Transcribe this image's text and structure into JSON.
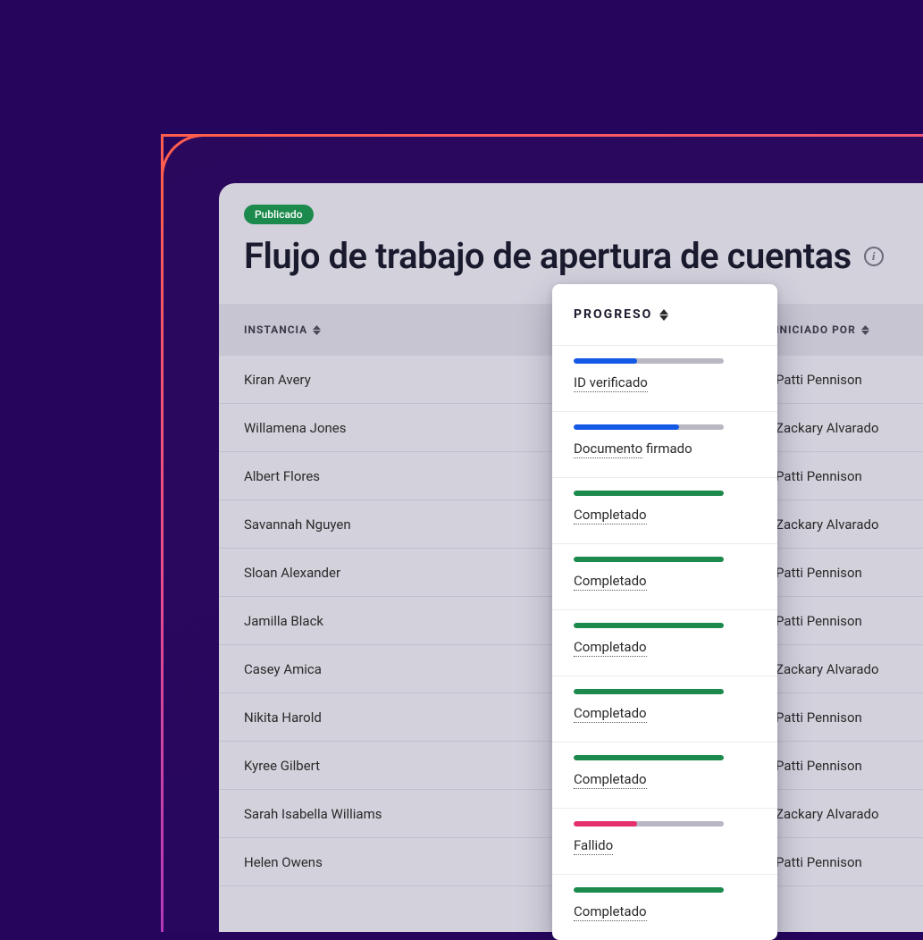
{
  "header": {
    "badge": "Publicado",
    "title": "Flujo de trabajo de apertura de cuentas"
  },
  "columns": {
    "instance": "INSTANCIA",
    "progress": "PROGRESO",
    "initiated_by": "INICIADO POR"
  },
  "rows": [
    {
      "instance": "Kiran Avery",
      "initiated_by": "Patti Pennison"
    },
    {
      "instance": "Willamena Jones",
      "initiated_by": "Zackary Alvarado"
    },
    {
      "instance": "Albert Flores",
      "initiated_by": "Patti Pennison"
    },
    {
      "instance": "Savannah Nguyen",
      "initiated_by": "Zackary Alvarado"
    },
    {
      "instance": "Sloan Alexander",
      "initiated_by": "Patti Pennison"
    },
    {
      "instance": "Jamilla Black",
      "initiated_by": "Patti Pennison"
    },
    {
      "instance": "Casey Amica",
      "initiated_by": "Zackary Alvarado"
    },
    {
      "instance": "Nikita Harold",
      "initiated_by": "Patti Pennison"
    },
    {
      "instance": "Kyree Gilbert",
      "initiated_by": "Patti Pennison"
    },
    {
      "instance": "Sarah Isabella Williams",
      "initiated_by": "Zackary Alvarado"
    },
    {
      "instance": "Helen Owens",
      "initiated_by": "Patti Pennison"
    }
  ],
  "progress": [
    {
      "percent": 42,
      "color": "blue",
      "label_dotted": "ID verificado",
      "label_rest": ""
    },
    {
      "percent": 70,
      "color": "blue",
      "label_dotted": "Documento",
      "label_rest": " firmado"
    },
    {
      "percent": 100,
      "color": "green",
      "label_dotted": "Completado",
      "label_rest": ""
    },
    {
      "percent": 100,
      "color": "green",
      "label_dotted": "Completado",
      "label_rest": ""
    },
    {
      "percent": 100,
      "color": "green",
      "label_dotted": "Completado",
      "label_rest": ""
    },
    {
      "percent": 100,
      "color": "green",
      "label_dotted": "Completado",
      "label_rest": ""
    },
    {
      "percent": 100,
      "color": "green",
      "label_dotted": "Completado",
      "label_rest": ""
    },
    {
      "percent": 42,
      "color": "red",
      "label_dotted": "Fallido",
      "label_rest": ""
    },
    {
      "percent": 100,
      "color": "green",
      "label_dotted": "Completado",
      "label_rest": ""
    }
  ],
  "colors": {
    "blue": "#1458e6",
    "green": "#1c8a4c",
    "red": "#e5316b"
  }
}
